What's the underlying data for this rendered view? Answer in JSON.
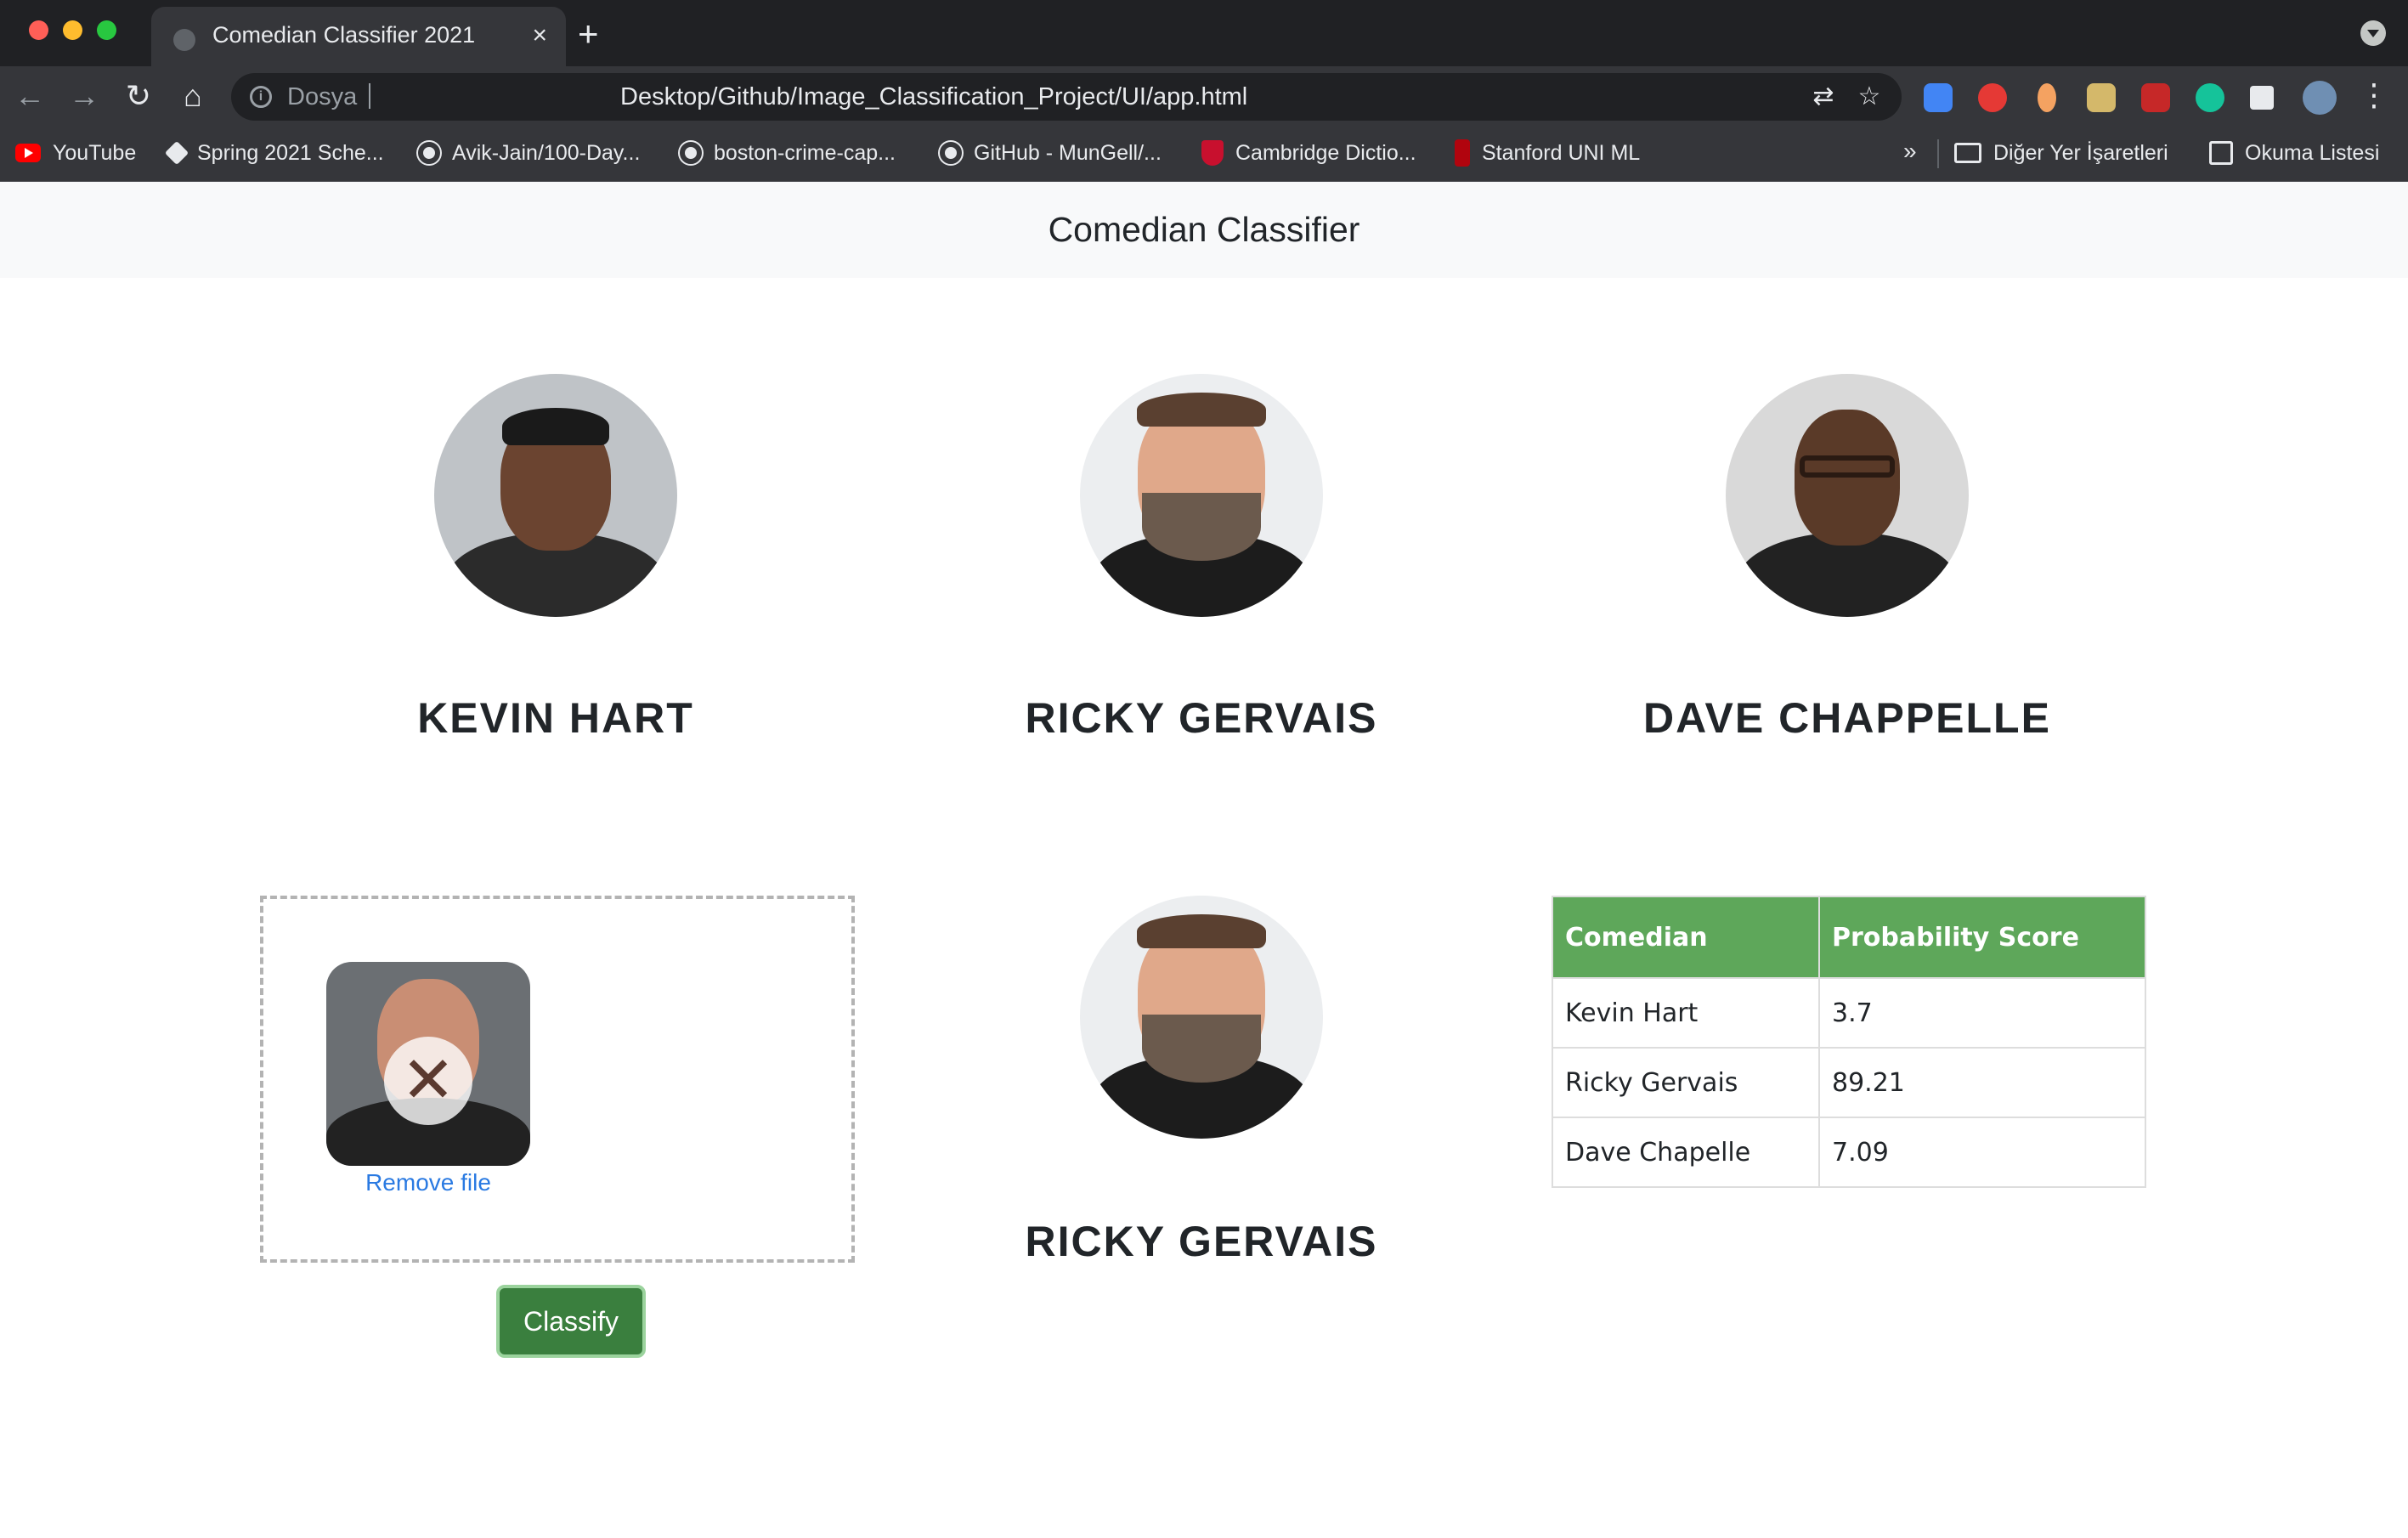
{
  "browser": {
    "tab_title": "Comedian Classifier 2021",
    "tab_close": "×",
    "new_tab": "+",
    "address_label": "Dosya",
    "url": "Desktop/Github/Image_Classification_Project/UI/app.html",
    "bookmarks": [
      {
        "label": "YouTube",
        "icon": "youtube-icon"
      },
      {
        "label": "Spring 2021 Sche...",
        "icon": "page-icon"
      },
      {
        "label": "Avik-Jain/100-Day...",
        "icon": "github-icon"
      },
      {
        "label": "boston-crime-cap...",
        "icon": "github-icon"
      },
      {
        "label": "GitHub - MunGell/...",
        "icon": "github-icon"
      },
      {
        "label": "Cambridge Dictio...",
        "icon": "cambridge-icon"
      },
      {
        "label": "Stanford UNI ML",
        "icon": "stanford-icon"
      }
    ],
    "more_bookmarks": "»",
    "other_bookmarks": "Diğer Yer İşaretleri",
    "reading_list": "Okuma Listesi"
  },
  "page": {
    "title": "Comedian Classifier"
  },
  "comedians": [
    {
      "name": "KEVIN HART"
    },
    {
      "name": "RICKY GERVAIS"
    },
    {
      "name": "DAVE CHAPPELLE"
    }
  ],
  "upload": {
    "remove_label": "Remove file",
    "classify_label": "Classify"
  },
  "result": {
    "name": "RICKY GERVAIS"
  },
  "table": {
    "headers": [
      "Comedian",
      "Probability Score"
    ],
    "rows": [
      [
        "Kevin Hart",
        "3.7"
      ],
      [
        "Ricky Gervais",
        "89.21"
      ],
      [
        "Dave Chapelle",
        "7.09"
      ]
    ]
  },
  "colors": {
    "table_header": "#5ea75a",
    "classify_button": "#3a7f3e",
    "link": "#2a7ae2"
  }
}
